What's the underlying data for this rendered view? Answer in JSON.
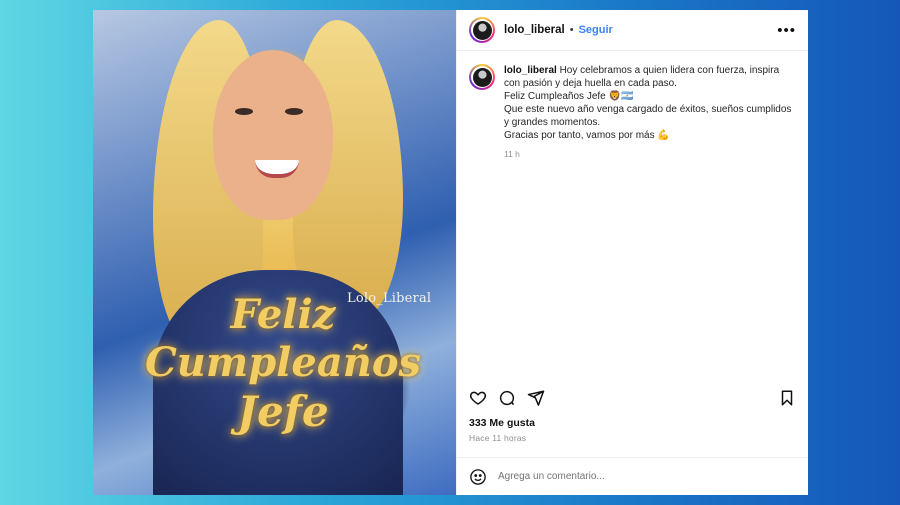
{
  "post": {
    "image": {
      "watermark": "Lolo_Liberal",
      "greeting_line1": "Feliz",
      "greeting_line2": "Cumpleaños",
      "greeting_line3": "Jefe"
    },
    "header": {
      "username": "lolo_liberal",
      "separator": "•",
      "follow_label": "Seguir",
      "more_icon": "more-horizontal-icon"
    },
    "caption": {
      "username": "lolo_liberal",
      "line1": "Hoy celebramos a quien lidera con fuerza, inspira con pasión y deja huella en cada paso.",
      "line2": "Feliz Cumpleaños Jefe 🦁🇦🇷",
      "line3": "Que este nuevo año venga cargado de éxitos, sueños cumplidos y grandes momentos.",
      "line4": "Gracias por tanto, vamos por más 💪",
      "time": "11 h"
    },
    "actions": {
      "like_icon": "heart-icon",
      "comment_icon": "comment-icon",
      "share_icon": "send-icon",
      "save_icon": "bookmark-icon"
    },
    "likes": "333 Me gusta",
    "posted_ago": "Hace 11 horas",
    "comment_box": {
      "emoji_icon": "smiley-icon",
      "placeholder": "Agrega un comentario..."
    }
  }
}
